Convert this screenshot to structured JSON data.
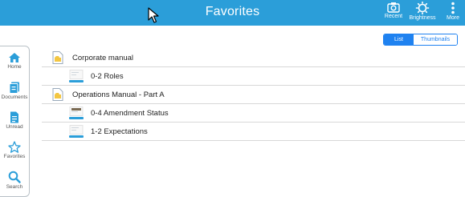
{
  "header": {
    "title": "Favorites",
    "buttons": [
      {
        "label": "Recent",
        "icon": "camera-icon"
      },
      {
        "label": "Brightness",
        "icon": "sun-icon"
      },
      {
        "label": "More",
        "icon": "more-vertical-icon"
      }
    ]
  },
  "view_toggle": {
    "options": [
      "List",
      "Thumbnails"
    ],
    "selected": "List"
  },
  "sidebar": {
    "items": [
      {
        "label": "Home",
        "icon": "home-icon"
      },
      {
        "label": "Documents",
        "icon": "documents-icon"
      },
      {
        "label": "Unread",
        "icon": "unread-icon"
      },
      {
        "label": "Favorites",
        "icon": "star-icon"
      },
      {
        "label": "Search",
        "icon": "search-icon"
      }
    ]
  },
  "documents": [
    {
      "title": "Corporate manual",
      "level": 0,
      "icon": "folder-doc-icon"
    },
    {
      "title": "0-2 Roles",
      "level": 1,
      "icon": "page-thumbnail-icon"
    },
    {
      "title": "Operations Manual - Part A",
      "level": 0,
      "icon": "folder-doc-icon"
    },
    {
      "title": "0-4 Amendment Status",
      "level": 1,
      "icon": "page-thumbnail-icon"
    },
    {
      "title": "1-2 Expectations",
      "level": 1,
      "icon": "page-thumbnail-icon"
    }
  ],
  "colors": {
    "header_bg": "#2b9ed9",
    "accent": "#1f82f0",
    "sidebar_icon": "#2b9ed9"
  }
}
